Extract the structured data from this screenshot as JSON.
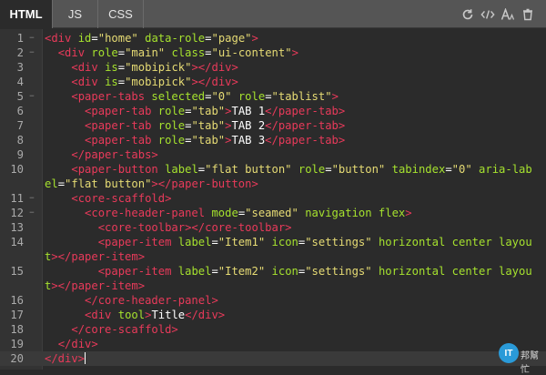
{
  "tabs": [
    {
      "label": "HTML",
      "active": true
    },
    {
      "label": "JS",
      "active": false
    },
    {
      "label": "CSS",
      "active": false
    }
  ],
  "toolbar": {
    "icons": [
      "refresh-icon",
      "code-icon",
      "font-icon",
      "delete-icon"
    ]
  },
  "colors": {
    "tag": "#e83a5a",
    "attribute": "#a6e22e",
    "string": "#e6db74",
    "text": "#ffffff",
    "background": "#2b2b2b",
    "tab_bar": "#555555"
  },
  "code": {
    "lines": [
      {
        "n": "1",
        "fold": true,
        "tokens": [
          [
            "tag",
            "<div"
          ],
          [
            "pl",
            " "
          ],
          [
            "at",
            "id"
          ],
          [
            "pl",
            "="
          ],
          [
            "str",
            "\"home\""
          ],
          [
            "pl",
            " "
          ],
          [
            "at",
            "data-role"
          ],
          [
            "pl",
            "="
          ],
          [
            "str",
            "\"page\""
          ],
          [
            "tag",
            ">"
          ]
        ]
      },
      {
        "n": "2",
        "fold": true,
        "tokens": [
          [
            "pl",
            "  "
          ],
          [
            "tag",
            "<div"
          ],
          [
            "pl",
            " "
          ],
          [
            "at",
            "role"
          ],
          [
            "pl",
            "="
          ],
          [
            "str",
            "\"main\""
          ],
          [
            "pl",
            " "
          ],
          [
            "at",
            "class"
          ],
          [
            "pl",
            "="
          ],
          [
            "str",
            "\"ui-content\""
          ],
          [
            "tag",
            ">"
          ]
        ]
      },
      {
        "n": "3",
        "fold": false,
        "tokens": [
          [
            "pl",
            "    "
          ],
          [
            "tag",
            "<div"
          ],
          [
            "pl",
            " "
          ],
          [
            "at",
            "is"
          ],
          [
            "pl",
            "="
          ],
          [
            "str",
            "\"mobipick\""
          ],
          [
            "tag",
            "></div>"
          ]
        ]
      },
      {
        "n": "4",
        "fold": false,
        "tokens": [
          [
            "pl",
            "    "
          ],
          [
            "tag",
            "<div"
          ],
          [
            "pl",
            " "
          ],
          [
            "at",
            "is"
          ],
          [
            "pl",
            "="
          ],
          [
            "str",
            "\"mobipick\""
          ],
          [
            "tag",
            "></div>"
          ]
        ]
      },
      {
        "n": "5",
        "fold": true,
        "tokens": [
          [
            "pl",
            "    "
          ],
          [
            "tag",
            "<paper-tabs"
          ],
          [
            "pl",
            " "
          ],
          [
            "at",
            "selected"
          ],
          [
            "pl",
            "="
          ],
          [
            "str",
            "\"0\""
          ],
          [
            "pl",
            " "
          ],
          [
            "at",
            "role"
          ],
          [
            "pl",
            "="
          ],
          [
            "str",
            "\"tablist\""
          ],
          [
            "tag",
            ">"
          ]
        ]
      },
      {
        "n": "6",
        "fold": false,
        "tokens": [
          [
            "pl",
            "      "
          ],
          [
            "tag",
            "<paper-tab"
          ],
          [
            "pl",
            " "
          ],
          [
            "at",
            "role"
          ],
          [
            "pl",
            "="
          ],
          [
            "str",
            "\"tab\""
          ],
          [
            "tag",
            ">"
          ],
          [
            "pl",
            "TAB 1"
          ],
          [
            "tag",
            "</paper-tab>"
          ]
        ]
      },
      {
        "n": "7",
        "fold": false,
        "tokens": [
          [
            "pl",
            "      "
          ],
          [
            "tag",
            "<paper-tab"
          ],
          [
            "pl",
            " "
          ],
          [
            "at",
            "role"
          ],
          [
            "pl",
            "="
          ],
          [
            "str",
            "\"tab\""
          ],
          [
            "tag",
            ">"
          ],
          [
            "pl",
            "TAB 2"
          ],
          [
            "tag",
            "</paper-tab>"
          ]
        ]
      },
      {
        "n": "8",
        "fold": false,
        "tokens": [
          [
            "pl",
            "      "
          ],
          [
            "tag",
            "<paper-tab"
          ],
          [
            "pl",
            " "
          ],
          [
            "at",
            "role"
          ],
          [
            "pl",
            "="
          ],
          [
            "str",
            "\"tab\""
          ],
          [
            "tag",
            ">"
          ],
          [
            "pl",
            "TAB 3"
          ],
          [
            "tag",
            "</paper-tab>"
          ]
        ]
      },
      {
        "n": "9",
        "fold": false,
        "tokens": [
          [
            "pl",
            "    "
          ],
          [
            "tag",
            "</paper-tabs>"
          ]
        ]
      },
      {
        "n": "10",
        "fold": false,
        "tokens": [
          [
            "pl",
            "    "
          ],
          [
            "tag",
            "<paper-button"
          ],
          [
            "pl",
            " "
          ],
          [
            "at",
            "label"
          ],
          [
            "pl",
            "="
          ],
          [
            "str",
            "\"flat button\""
          ],
          [
            "pl",
            " "
          ],
          [
            "at",
            "role"
          ],
          [
            "pl",
            "="
          ],
          [
            "str",
            "\"button\""
          ],
          [
            "pl",
            " "
          ],
          [
            "at",
            "tabindex"
          ],
          [
            "pl",
            "="
          ],
          [
            "str",
            "\"0\""
          ],
          [
            "pl",
            " "
          ],
          [
            "at",
            "aria-label"
          ],
          [
            "pl",
            "="
          ],
          [
            "str",
            "\"flat button\""
          ],
          [
            "tag",
            "></paper-button>"
          ]
        ]
      },
      {
        "n": "11",
        "fold": true,
        "tokens": [
          [
            "pl",
            "    "
          ],
          [
            "tag",
            "<core-scaffold>"
          ]
        ]
      },
      {
        "n": "12",
        "fold": true,
        "tokens": [
          [
            "pl",
            "      "
          ],
          [
            "tag",
            "<core-header-panel"
          ],
          [
            "pl",
            " "
          ],
          [
            "at",
            "mode"
          ],
          [
            "pl",
            "="
          ],
          [
            "str",
            "\"seamed\""
          ],
          [
            "pl",
            " "
          ],
          [
            "at",
            "navigation flex"
          ],
          [
            "tag",
            ">"
          ]
        ]
      },
      {
        "n": "13",
        "fold": false,
        "tokens": [
          [
            "pl",
            "        "
          ],
          [
            "tag",
            "<core-toolbar></core-toolbar>"
          ]
        ]
      },
      {
        "n": "14",
        "fold": false,
        "tokens": [
          [
            "pl",
            "        "
          ],
          [
            "tag",
            "<paper-item"
          ],
          [
            "pl",
            " "
          ],
          [
            "at",
            "label"
          ],
          [
            "pl",
            "="
          ],
          [
            "str",
            "\"Item1\""
          ],
          [
            "pl",
            " "
          ],
          [
            "at",
            "icon"
          ],
          [
            "pl",
            "="
          ],
          [
            "str",
            "\"settings\""
          ],
          [
            "pl",
            " "
          ],
          [
            "at",
            "horizontal center layout"
          ],
          [
            "tag",
            "></paper-item>"
          ]
        ]
      },
      {
        "n": "15",
        "fold": false,
        "tokens": [
          [
            "pl",
            "        "
          ],
          [
            "tag",
            "<paper-item"
          ],
          [
            "pl",
            " "
          ],
          [
            "at",
            "label"
          ],
          [
            "pl",
            "="
          ],
          [
            "str",
            "\"Item2\""
          ],
          [
            "pl",
            " "
          ],
          [
            "at",
            "icon"
          ],
          [
            "pl",
            "="
          ],
          [
            "str",
            "\"settings\""
          ],
          [
            "pl",
            " "
          ],
          [
            "at",
            "horizontal center layout"
          ],
          [
            "tag",
            "></paper-item>"
          ]
        ]
      },
      {
        "n": "16",
        "fold": false,
        "tokens": [
          [
            "pl",
            "      "
          ],
          [
            "tag",
            "</core-header-panel>"
          ]
        ]
      },
      {
        "n": "17",
        "fold": false,
        "tokens": [
          [
            "pl",
            "      "
          ],
          [
            "tag",
            "<div"
          ],
          [
            "pl",
            " "
          ],
          [
            "at",
            "tool"
          ],
          [
            "tag",
            ">"
          ],
          [
            "pl",
            "Title"
          ],
          [
            "tag",
            "</div>"
          ]
        ]
      },
      {
        "n": "18",
        "fold": false,
        "tokens": [
          [
            "pl",
            "    "
          ],
          [
            "tag",
            "</core-scaffold>"
          ]
        ]
      },
      {
        "n": "19",
        "fold": false,
        "tokens": [
          [
            "pl",
            "  "
          ],
          [
            "tag",
            "</div>"
          ]
        ]
      },
      {
        "n": "20",
        "fold": false,
        "tokens": [
          [
            "tag",
            "</div>"
          ]
        ]
      }
    ]
  },
  "cursor_line": 20,
  "watermark": {
    "badge": "IT",
    "text": "邦幫忙"
  }
}
